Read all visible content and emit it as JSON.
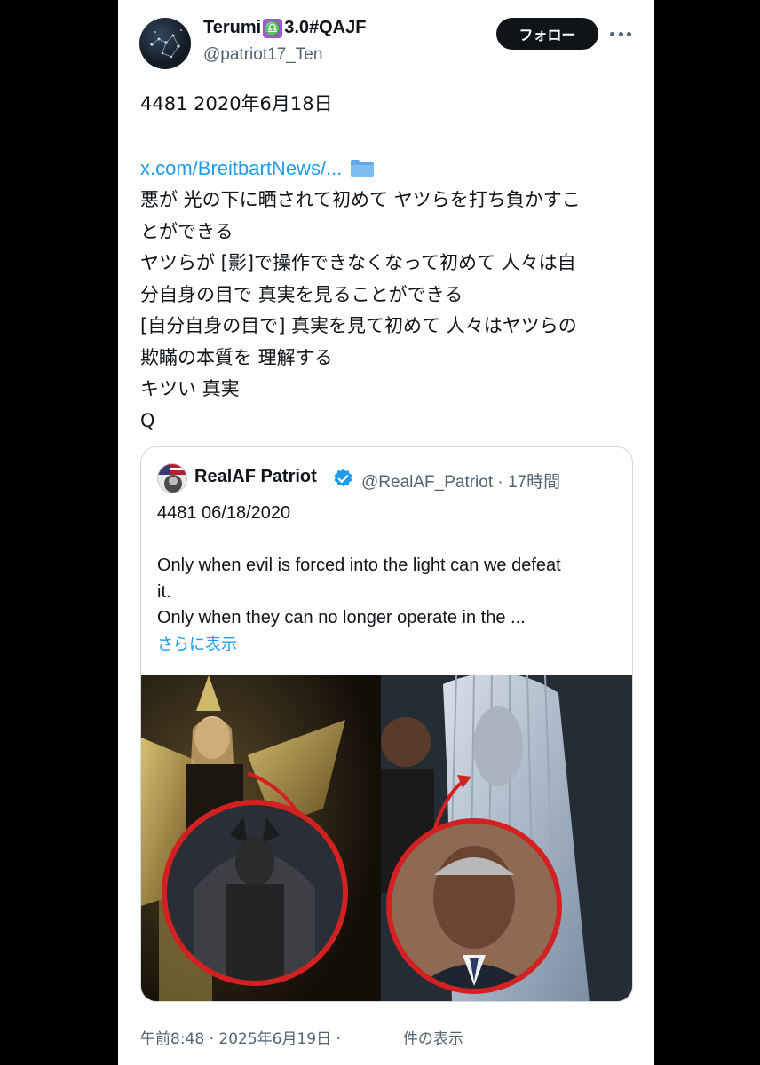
{
  "tweet": {
    "display_name": "Terumi",
    "badge_glyph": "♎",
    "name_suffix": "3.0#QAJF",
    "handle": "@patriot17_Ten",
    "follow_label": "フォロー",
    "more_icon": "more-dots-icon",
    "lines": [
      "4481 2020年6月18日",
      "",
      "悪が 光の下に晒されて初めて ヤツらを打ち負かすこ",
      "とができる",
      "ヤツらが [影]で操作できなくなって初めて 人々は自",
      "分自身の目で 真実を見ることができる",
      "[自分自身の目で] 真実を見て初めて 人々はヤツらの",
      "欺瞞の本質を 理解する",
      "キツい 真実",
      "Q"
    ],
    "link_text": "x.com/BreitbartNews/...",
    "timestamp": "午前8:48 · 2025年6月19日 ·",
    "views_label": "件の表示"
  },
  "quote": {
    "name": "RealAF Patriot",
    "handle_time": "@RealAF_Patriot · 17時間",
    "lines": [
      "4481    06/18/2020",
      "",
      "Only when evil is forced into the light can we defeat",
      "it.",
      "Only when they can no longer operate in the ..."
    ],
    "show_more": "さらに表示"
  },
  "colors": {
    "link": "#1d9bf0",
    "secondary_text": "#536471",
    "follow_bg": "#0f1419",
    "verified": "#1d9bf0",
    "circle_highlight": "#d32020"
  }
}
